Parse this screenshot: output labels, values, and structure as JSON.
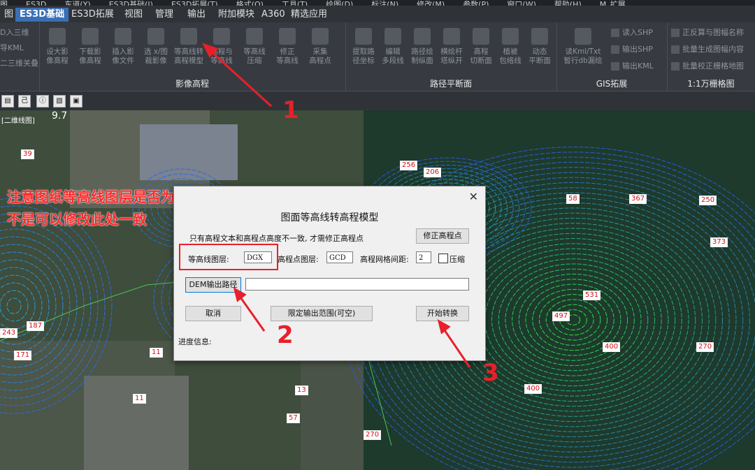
{
  "menubar": [
    "图",
    "ES3D",
    "东道(Y)",
    "ES3D基础(I)",
    "ES3D拓展(T)",
    "格式(O)",
    "工具(T)",
    "绘图(D)",
    "标注(N)",
    "修改(M)",
    "参数(P)",
    "窗口(W)",
    "帮助(H)",
    "M_扩展"
  ],
  "ribbon_tabs": [
    "图",
    "ES3D基础",
    "ES3D拓展",
    "视图",
    "管理",
    "输出",
    "附加模块",
    "A360",
    "精选应用"
  ],
  "active_tab": "ES3D基础",
  "groups": {
    "g1_left_items": [
      "D入三维",
      "导KML",
      "二三维关叠"
    ],
    "yingxiang_buttons": [
      {
        "l1": "设大影",
        "l2": "像高程"
      },
      {
        "l1": "下载影",
        "l2": "像高程"
      },
      {
        "l1": "插入影",
        "l2": "像文件"
      },
      {
        "l1": "选 x/图",
        "l2": "裁影像"
      },
      {
        "l1": "等高线转",
        "l2": "高程模型"
      },
      {
        "l1": "高程与",
        "l2": "等高线"
      },
      {
        "l1": "等高线",
        "l2": "压缩"
      },
      {
        "l1": "修正",
        "l2": "等高线"
      },
      {
        "l1": "采集",
        "l2": "高程点"
      }
    ],
    "yingxiang_title": "影像高程",
    "lujing_buttons": [
      {
        "l1": "提取路",
        "l2": "径坐标"
      },
      {
        "l1": "编辑",
        "l2": "多段线"
      },
      {
        "l1": "路径绘",
        "l2": "制纵面"
      },
      {
        "l1": "横绘杆",
        "l2": "塔纵开"
      },
      {
        "l1": "高程",
        "l2": "切断面"
      },
      {
        "l1": "植被",
        "l2": "包络线"
      },
      {
        "l1": "动态",
        "l2": "平断面"
      }
    ],
    "lujing_title": "路径平断面",
    "gis_buttons": [
      {
        "l1": "读Kml/Txt",
        "l2": "暂行db漏绘"
      }
    ],
    "gis_small": [
      "读入SHP",
      "输出SHP",
      "输出KML"
    ],
    "gis_title": "GIS拓展",
    "grid_small": [
      "正反算与图幅名称",
      "批量生成图幅内容",
      "批量校正栅格地图"
    ],
    "grid_title": "1:1万栅格图"
  },
  "toolbar_icons": [
    "layout-icon",
    "text-icon",
    "info-icon",
    "hatch-icon",
    "clipboard-icon"
  ],
  "view": {
    "label": "[二维线图]",
    "number": "9.7"
  },
  "elevations": [
    {
      "t": "39"
    },
    {
      "t": "256"
    },
    {
      "t": "206"
    },
    {
      "t": "58"
    },
    {
      "t": "367"
    },
    {
      "t": "250"
    },
    {
      "t": "373"
    },
    {
      "t": "531"
    },
    {
      "t": "497"
    },
    {
      "t": "400"
    },
    {
      "t": "270"
    },
    {
      "t": "400"
    },
    {
      "t": "187"
    },
    {
      "t": "243"
    },
    {
      "t": "171"
    },
    {
      "t": "11"
    },
    {
      "t": "13"
    },
    {
      "t": "11"
    },
    {
      "t": "57"
    },
    {
      "t": "270"
    }
  ],
  "dialog": {
    "title": "图面等高线转高程模型",
    "hint": "只有高程文本和高程点高度不一致, 才需修正高程点",
    "fix_button": "修正高程点",
    "contour_layer_label": "等高线图层:",
    "contour_layer_value": "DGX",
    "point_layer_label": "高程点图层:",
    "point_layer_value": "GCD",
    "grid_label": "高程网格间距:",
    "grid_value": "2",
    "compress_label": "压缩",
    "dem_button": "DEM输出路径",
    "dem_path": "",
    "cancel": "取消",
    "limit": "限定输出范围(可空)",
    "start": "开始转换",
    "progress_label": "进度信息:"
  },
  "annotation": {
    "line1": "注意图纸等高线图层是否为DGX,",
    "line2": "不是可以修改此处一致",
    "step1": "1",
    "step2": "2",
    "step3": "3"
  },
  "colors": {
    "accent_tab": "#3a6fb5",
    "annotation_red": "#e8202a",
    "contour_blue": "#2f7bd6",
    "contour_green": "#39d84a"
  }
}
